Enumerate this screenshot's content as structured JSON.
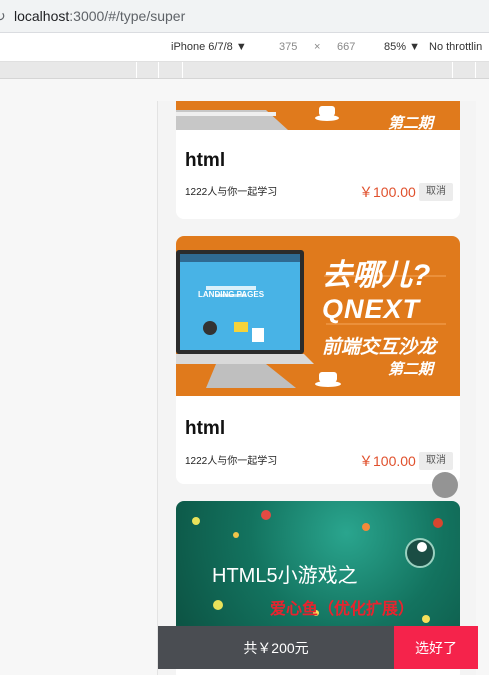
{
  "browser": {
    "url_host": "localhost",
    "url_path": ":3000/#/type/super"
  },
  "device_toolbar": {
    "device": "iPhone 6/7/8",
    "width": "375",
    "times": "×",
    "height": "667",
    "zoom": "85%",
    "throttle": "No throttlin"
  },
  "cards": [
    {
      "banner_text": "第二期",
      "title": "html",
      "subtitle": "1222人与你一起学习",
      "price": "￥100.00",
      "cancel": "取消"
    },
    {
      "banner_line1": "去哪儿?",
      "banner_line2": "QNEXT",
      "banner_line3": "前端交互沙龙",
      "banner_line4": "第二期",
      "screen_caption": "LANDING PAGES",
      "title": "html",
      "subtitle": "1222人与你一起学习",
      "price": "￥100.00",
      "cancel": "取消"
    },
    {
      "banner_line1": "HTML5小游戏之",
      "banner_line2": "爱心鱼（优化扩展）"
    }
  ],
  "bottom": {
    "total": "共￥200元",
    "done": "选好了"
  },
  "colors": {
    "accent_red": "#f5234b",
    "price_red": "#e0502c",
    "banner_orange": "#e07a1c",
    "bar_dark": "#4a4d52"
  }
}
